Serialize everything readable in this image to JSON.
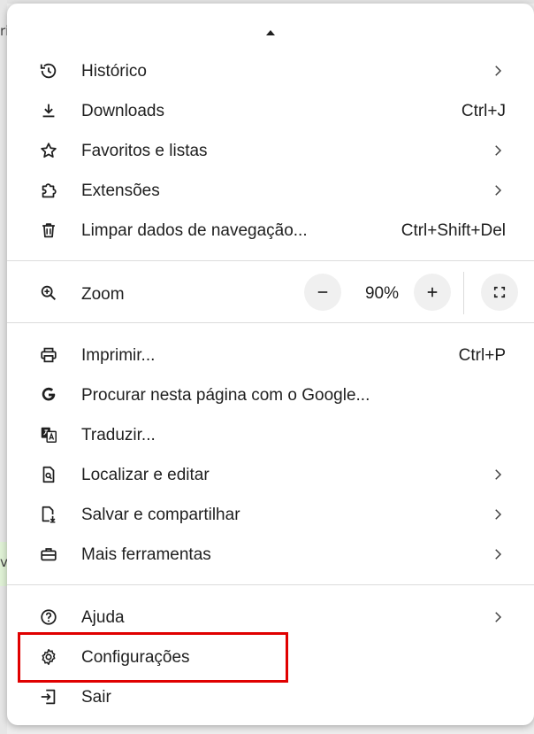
{
  "background": {
    "text_top": "ri",
    "text_left": "v"
  },
  "menu": {
    "items": [
      {
        "key": "historico",
        "label": "Histórico",
        "shortcut": "",
        "icon": "history-icon",
        "submenu": true
      },
      {
        "key": "downloads",
        "label": "Downloads",
        "shortcut": "Ctrl+J",
        "icon": "download-icon",
        "submenu": false
      },
      {
        "key": "favoritos",
        "label": "Favoritos e listas",
        "shortcut": "",
        "icon": "star-icon",
        "submenu": true
      },
      {
        "key": "extensoes",
        "label": "Extensões",
        "shortcut": "",
        "icon": "puzzle-icon",
        "submenu": true
      },
      {
        "key": "limpar",
        "label": "Limpar dados de navegação...",
        "shortcut": "Ctrl+Shift+Del",
        "icon": "trash-icon",
        "submenu": false
      }
    ],
    "zoom": {
      "label": "Zoom",
      "value": "90%",
      "icon": "zoom-in-icon"
    },
    "tools": [
      {
        "key": "imprimir",
        "label": "Imprimir...",
        "shortcut": "Ctrl+P",
        "icon": "printer-icon",
        "submenu": false
      },
      {
        "key": "google",
        "label": "Procurar nesta página com o Google...",
        "shortcut": "",
        "icon": "google-icon",
        "submenu": false
      },
      {
        "key": "traduzir",
        "label": "Traduzir...",
        "shortcut": "",
        "icon": "translate-icon",
        "submenu": false
      },
      {
        "key": "localizar",
        "label": "Localizar e editar",
        "shortcut": "",
        "icon": "find-page-icon",
        "submenu": true
      },
      {
        "key": "salvar",
        "label": "Salvar e compartilhar",
        "shortcut": "",
        "icon": "save-share-icon",
        "submenu": true
      },
      {
        "key": "ferramentas",
        "label": "Mais ferramentas",
        "shortcut": "",
        "icon": "toolbox-icon",
        "submenu": true
      }
    ],
    "bottom": [
      {
        "key": "ajuda",
        "label": "Ajuda",
        "shortcut": "",
        "icon": "help-icon",
        "submenu": true
      },
      {
        "key": "configuracoes",
        "label": "Configurações",
        "shortcut": "",
        "icon": "gear-icon",
        "submenu": false
      },
      {
        "key": "sair",
        "label": "Sair",
        "shortcut": "",
        "icon": "exit-icon",
        "submenu": false
      }
    ]
  },
  "colors": {
    "highlight": "#e00000",
    "menu_bg": "#ffffff",
    "text": "#1f1f1f"
  }
}
